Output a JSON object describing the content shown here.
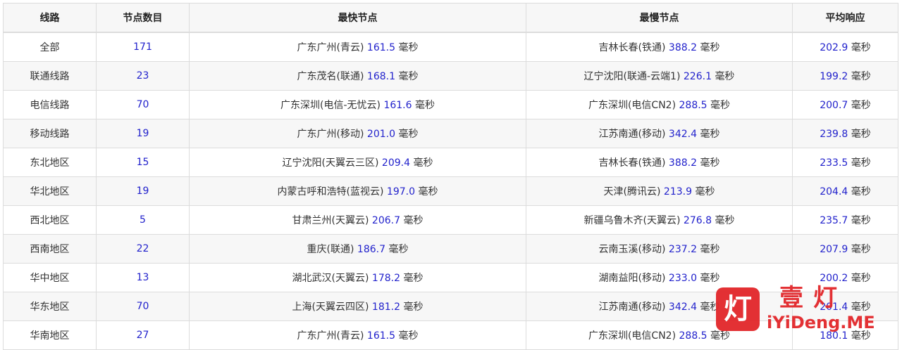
{
  "table": {
    "headers": [
      "线路",
      "节点数目",
      "最快节点",
      "最慢节点",
      "平均响应"
    ],
    "unit": "毫秒",
    "rows": [
      {
        "route": "全部",
        "count": "171",
        "fast_name": "广东广州(青云)",
        "fast_ms": "161.5",
        "slow_name": "吉林长春(铁通)",
        "slow_ms": "388.2",
        "avg_ms": "202.9"
      },
      {
        "route": "联通线路",
        "count": "23",
        "fast_name": "广东茂名(联通)",
        "fast_ms": "168.1",
        "slow_name": "辽宁沈阳(联通-云端1)",
        "slow_ms": "226.1",
        "avg_ms": "199.2"
      },
      {
        "route": "电信线路",
        "count": "70",
        "fast_name": "广东深圳(电信-无忧云)",
        "fast_ms": "161.6",
        "slow_name": "广东深圳(电信CN2)",
        "slow_ms": "288.5",
        "avg_ms": "200.7"
      },
      {
        "route": "移动线路",
        "count": "19",
        "fast_name": "广东广州(移动)",
        "fast_ms": "201.0",
        "slow_name": "江苏南通(移动)",
        "slow_ms": "342.4",
        "avg_ms": "239.8"
      },
      {
        "route": "东北地区",
        "count": "15",
        "fast_name": "辽宁沈阳(天翼云三区)",
        "fast_ms": "209.4",
        "slow_name": "吉林长春(铁通)",
        "slow_ms": "388.2",
        "avg_ms": "233.5"
      },
      {
        "route": "华北地区",
        "count": "19",
        "fast_name": "内蒙古呼和浩特(蓝视云)",
        "fast_ms": "197.0",
        "slow_name": "天津(腾讯云)",
        "slow_ms": "213.9",
        "avg_ms": "204.4"
      },
      {
        "route": "西北地区",
        "count": "5",
        "fast_name": "甘肃兰州(天翼云)",
        "fast_ms": "206.7",
        "slow_name": "新疆乌鲁木齐(天翼云)",
        "slow_ms": "276.8",
        "avg_ms": "235.7"
      },
      {
        "route": "西南地区",
        "count": "22",
        "fast_name": "重庆(联通)",
        "fast_ms": "186.7",
        "slow_name": "云南玉溪(移动)",
        "slow_ms": "237.2",
        "avg_ms": "207.9"
      },
      {
        "route": "华中地区",
        "count": "13",
        "fast_name": "湖北武汉(天翼云)",
        "fast_ms": "178.2",
        "slow_name": "湖南益阳(移动)",
        "slow_ms": "233.0",
        "avg_ms": "200.2"
      },
      {
        "route": "华东地区",
        "count": "70",
        "fast_name": "上海(天翼云四区)",
        "fast_ms": "181.2",
        "slow_name": "江苏南通(移动)",
        "slow_ms": "342.4",
        "avg_ms": "201.4"
      },
      {
        "route": "华南地区",
        "count": "27",
        "fast_name": "广东广州(青云)",
        "fast_ms": "161.5",
        "slow_name": "广东深圳(电信CN2)",
        "slow_ms": "288.5",
        "avg_ms": "180.1"
      }
    ]
  },
  "watermark": {
    "icon_char": "灯",
    "brand": "壹灯",
    "url": "iYiDeng.ME",
    "color": "#e2262a"
  },
  "colors": {
    "number": "#2222cc",
    "text": "#333333",
    "border": "#dcdcdc",
    "stripe": "#f7f7f7"
  }
}
